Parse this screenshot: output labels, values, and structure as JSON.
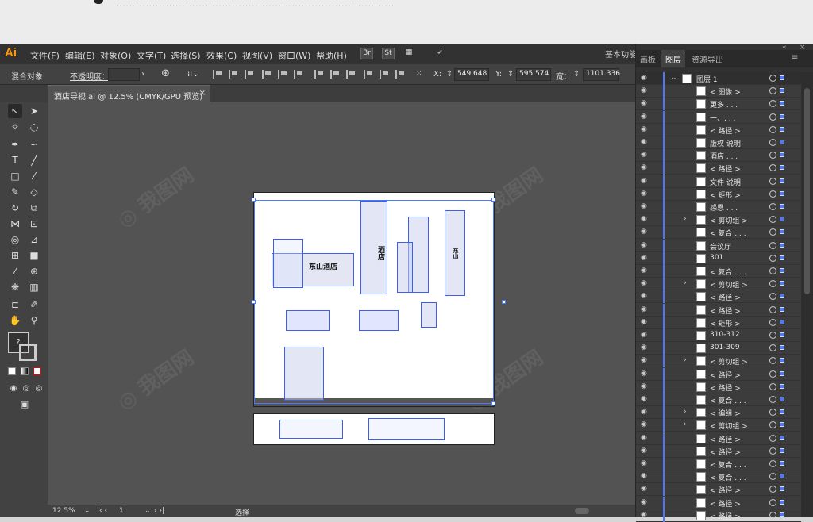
{
  "top_strip": {
    "blurred_text": "...................................................................................."
  },
  "app": {
    "logo": "Ai",
    "menu": [
      "文件(F)",
      "编辑(E)",
      "对象(O)",
      "文字(T)",
      "选择(S)",
      "效果(C)",
      "视图(V)",
      "窗口(W)",
      "帮助(H)"
    ],
    "bridge_icon": "Br",
    "stock_icon": "St",
    "workspace": "基本功能"
  },
  "controlbar": {
    "object_label": "混合对象",
    "opacity_label": "不透明度：",
    "x_label": "X:",
    "x_value": "549.648",
    "y_label": "Y:",
    "y_value": "595.574",
    "w_label": "宽：",
    "w_value": "1101.336"
  },
  "document": {
    "tab_title": "酒店导视.ai @ 12.5% (CMYK/GPU 预览)",
    "close": "×"
  },
  "artwork": {
    "hotel_name": "东山酒店",
    "vertical_text_1": "酒店",
    "vertical_text_2": "东山"
  },
  "status": {
    "zoom": "12.5%",
    "page": "1",
    "tool": "选择"
  },
  "panel": {
    "tabs": [
      "画板",
      "图层",
      "资源导出"
    ],
    "active_tab": "图层",
    "layers": [
      {
        "name": "图层 1",
        "arrow": "⌄",
        "top": true
      },
      {
        "name": "< 图像 >"
      },
      {
        "name": "更多 . . ."
      },
      {
        "name": "一、. . ."
      },
      {
        "name": "< 路径 >"
      },
      {
        "name": "版权 说明"
      },
      {
        "name": "酒店 . . ."
      },
      {
        "name": "< 路径 >"
      },
      {
        "name": "文件 说明"
      },
      {
        "name": "< 矩形 >"
      },
      {
        "name": "感恩 . . ."
      },
      {
        "name": "< 剪切组 >",
        "arrow": "›"
      },
      {
        "name": "< 复合 . . ."
      },
      {
        "name": "会议厅"
      },
      {
        "name": "301"
      },
      {
        "name": "< 复合 . . ."
      },
      {
        "name": "< 剪切组 >",
        "arrow": "›"
      },
      {
        "name": "< 路径 >"
      },
      {
        "name": "< 路径 >"
      },
      {
        "name": "< 矩形 >"
      },
      {
        "name": "310-312"
      },
      {
        "name": "301-309"
      },
      {
        "name": "< 剪切组 >",
        "arrow": "›"
      },
      {
        "name": "< 路径 >"
      },
      {
        "name": "< 路径 >"
      },
      {
        "name": "< 复合 . . ."
      },
      {
        "name": "< 编组 >",
        "arrow": "›"
      },
      {
        "name": "< 剪切组 >",
        "arrow": "›"
      },
      {
        "name": "< 路径 >"
      },
      {
        "name": "< 路径 >"
      },
      {
        "name": "< 复合 . . ."
      },
      {
        "name": "< 复合 . . ."
      },
      {
        "name": "< 路径 >"
      },
      {
        "name": "< 路径 >"
      },
      {
        "name": "< 路径 >"
      }
    ]
  },
  "colors": {
    "accent": "#4a78ff",
    "logo": "#ff9a00"
  }
}
